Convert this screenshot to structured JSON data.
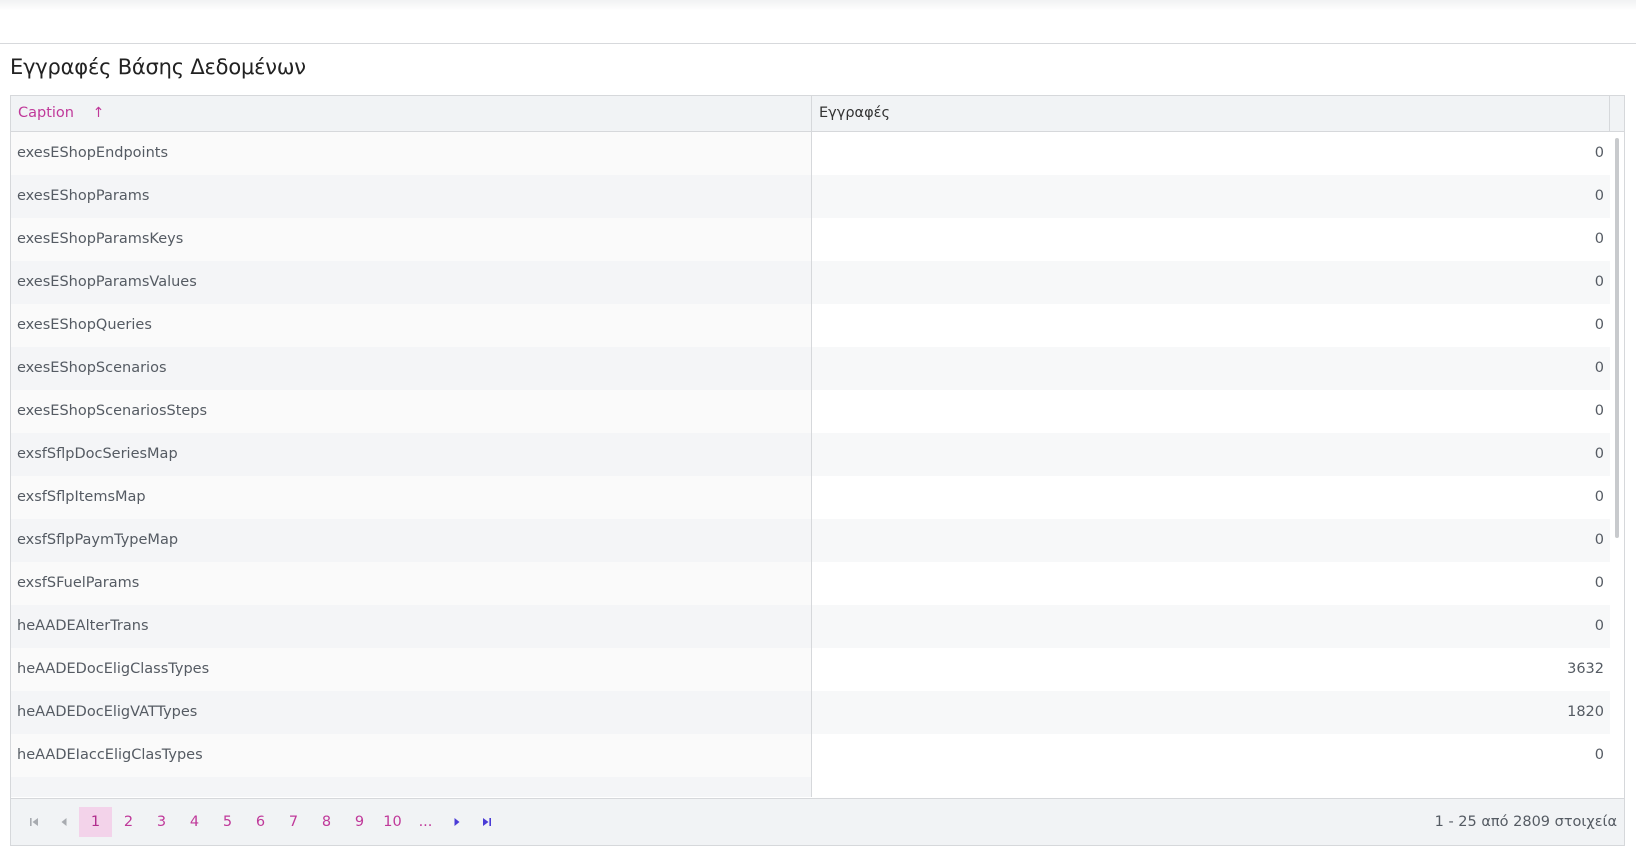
{
  "page": {
    "title": "Εγγραφές Βάσης Δεδομένων"
  },
  "grid": {
    "columns": {
      "caption": "Caption",
      "records": "Εγγραφές"
    },
    "sort_icon": "arrow-up-icon",
    "rows": [
      {
        "caption": "exesEShopEndpoints",
        "records": "0"
      },
      {
        "caption": "exesEShopParams",
        "records": "0"
      },
      {
        "caption": "exesEShopParamsKeys",
        "records": "0"
      },
      {
        "caption": "exesEShopParamsValues",
        "records": "0"
      },
      {
        "caption": "exesEShopQueries",
        "records": "0"
      },
      {
        "caption": "exesEShopScenarios",
        "records": "0"
      },
      {
        "caption": "exesEShopScenariosSteps",
        "records": "0"
      },
      {
        "caption": "exsfSflpDocSeriesMap",
        "records": "0"
      },
      {
        "caption": "exsfSflpItemsMap",
        "records": "0"
      },
      {
        "caption": "exsfSflpPaymTypeMap",
        "records": "0"
      },
      {
        "caption": "exsfSFuelParams",
        "records": "0"
      },
      {
        "caption": "heAADEAlterTrans",
        "records": "0"
      },
      {
        "caption": "heAADEDocEligClassTypes",
        "records": "3632"
      },
      {
        "caption": "heAADEDocEligVATTypes",
        "records": "1820"
      },
      {
        "caption": "heAADEIaccEligClasTypes",
        "records": "0"
      }
    ]
  },
  "pager": {
    "pages": [
      "1",
      "2",
      "3",
      "4",
      "5",
      "6",
      "7",
      "8",
      "9",
      "10",
      "..."
    ],
    "current": "1",
    "icons": {
      "first": "first-page-icon",
      "prev": "prev-page-icon",
      "next": "next-page-icon",
      "last": "last-page-icon"
    },
    "info": "1 - 25 από 2809 στοιχεία"
  },
  "colors": {
    "accent": "#c0399a",
    "current_page_bg": "#f3d3ea",
    "nav_active": "#4a3bd6"
  }
}
